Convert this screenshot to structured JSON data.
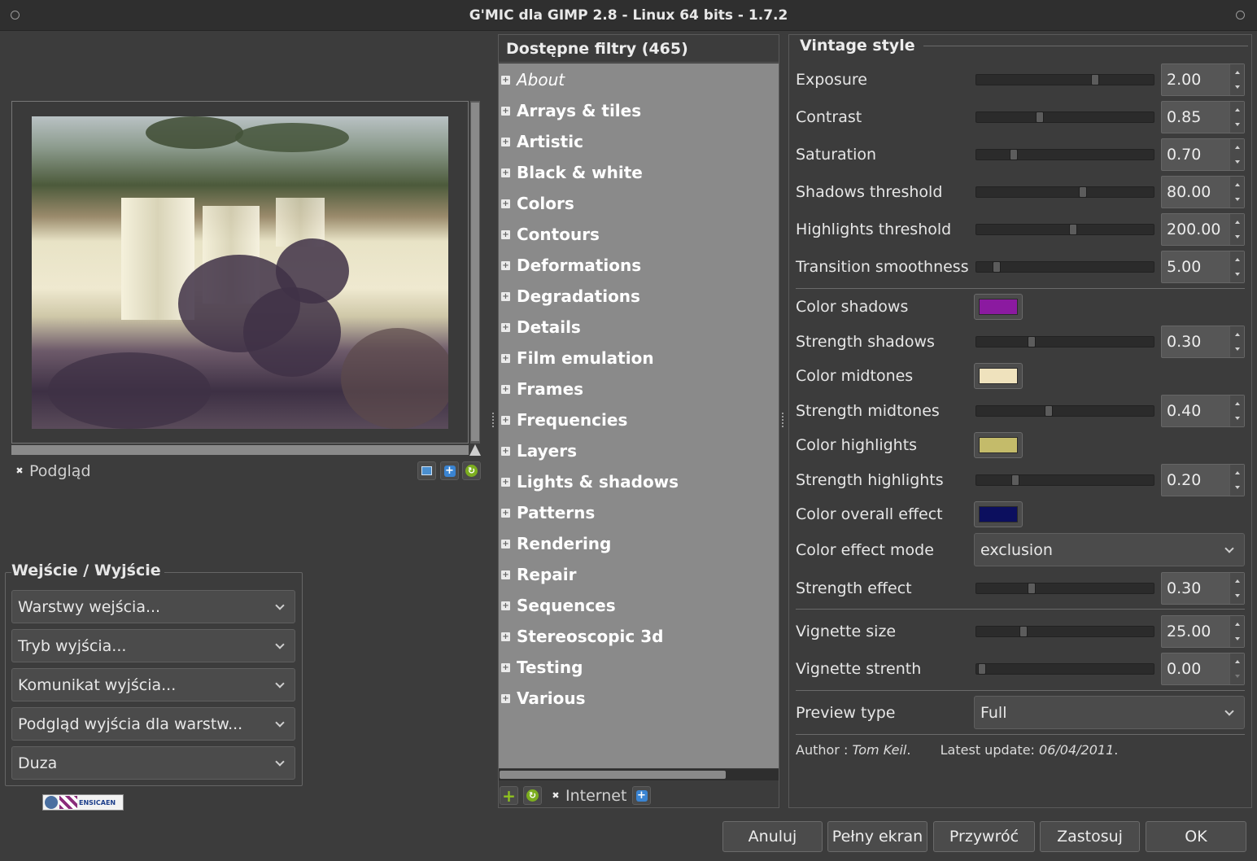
{
  "window": {
    "title": "G'MIC dla GIMP 2.8 - Linux 64 bits - 1.7.2"
  },
  "preview": {
    "checkbox_label": "Podgląd",
    "checkbox_checked": true
  },
  "io": {
    "title": "Wejście / Wyjście",
    "input_layers": "Warstwy wejścia...",
    "output_mode": "Tryb wyjścia...",
    "output_message": "Komunikat wyjścia...",
    "output_preview": "Podgląd wyjścia dla warstw...",
    "preview_size": "Duza"
  },
  "logo": {
    "text": "ENSICAEN"
  },
  "filters": {
    "header": "Dostępne filtry (465)",
    "items": [
      "About",
      "Arrays & tiles",
      "Artistic",
      "Black & white",
      "Colors",
      "Contours",
      "Deformations",
      "Degradations",
      "Details",
      "Film emulation",
      "Frames",
      "Frequencies",
      "Layers",
      "Lights & shadows",
      "Patterns",
      "Rendering",
      "Repair",
      "Sequences",
      "Stereoscopic 3d",
      "Testing",
      "Various"
    ],
    "internet_label": "Internet",
    "internet_checked": true
  },
  "params": {
    "title": "Vintage style",
    "exposure": {
      "label": "Exposure",
      "value": "2.00",
      "fraction": 0.68
    },
    "contrast": {
      "label": "Contrast",
      "value": "0.85",
      "fraction": 0.35
    },
    "saturation": {
      "label": "Saturation",
      "value": "0.70",
      "fraction": 0.19
    },
    "shadows_threshold": {
      "label": "Shadows threshold",
      "value": "80.00",
      "fraction": 0.61
    },
    "highlights_threshold": {
      "label": "Highlights threshold",
      "value": "200.00",
      "fraction": 0.55
    },
    "transition_smoothness": {
      "label": "Transition smoothness",
      "value": "5.00",
      "fraction": 0.09
    },
    "color_shadows": {
      "label": "Color shadows",
      "color": "#8b1aa0"
    },
    "strength_shadows": {
      "label": "Strength shadows",
      "value": "0.30",
      "fraction": 0.3
    },
    "color_midtones": {
      "label": "Color midtones",
      "color": "#efe2bd"
    },
    "strength_midtones": {
      "label": "Strength midtones",
      "value": "0.40",
      "fraction": 0.4
    },
    "color_highlights": {
      "label": "Color highlights",
      "color": "#c4bb6a"
    },
    "strength_highlights": {
      "label": "Strength highlights",
      "value": "0.20",
      "fraction": 0.2
    },
    "color_overall": {
      "label": "Color overall effect",
      "color": "#0c0f5e"
    },
    "color_effect_mode": {
      "label": "Color effect mode",
      "value": "exclusion"
    },
    "strength_effect": {
      "label": "Strength effect",
      "value": "0.30",
      "fraction": 0.3
    },
    "vignette_size": {
      "label": "Vignette size",
      "value": "25.00",
      "fraction": 0.25
    },
    "vignette_strenth": {
      "label": "Vignette strenth",
      "value": "0.00",
      "fraction": 0.0
    },
    "preview_type": {
      "label": "Preview type",
      "value": "Full"
    },
    "author_prefix": "Author : ",
    "author_name": "Tom Keil",
    "update_prefix": "Latest update: ",
    "update_date": "06/04/2011"
  },
  "buttons": {
    "cancel": "Anuluj",
    "fullscreen": "Pełny ekran",
    "reset": "Przywróć",
    "apply": "Zastosuj",
    "ok": "OK"
  }
}
